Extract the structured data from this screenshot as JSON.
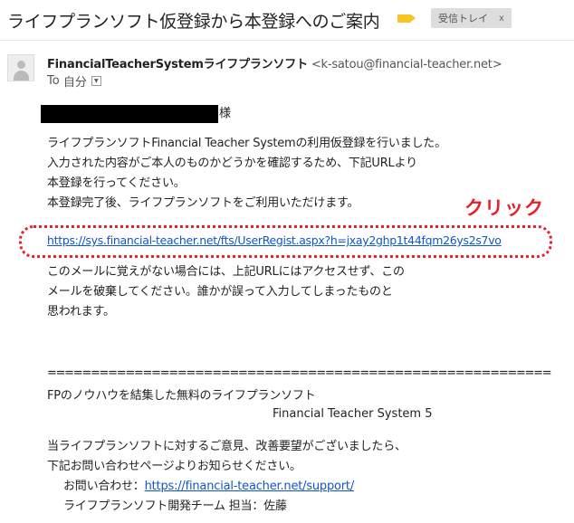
{
  "email": {
    "subject": "ライフプランソフト仮登録から本登録へのご案内",
    "label": {
      "text": "受信トレイ",
      "close": "x",
      "color": "#f3c624"
    },
    "sender": {
      "name": "FinancialTeacherSystemライフプランソフト",
      "email": "<k-satou@financial-teacher.net>"
    },
    "to": {
      "prefix": "To",
      "value": "自分"
    },
    "salutation": "様",
    "paragraph1": [
      "ライフプランソフトFinancial Teacher Systemの利用仮登録を行いました。",
      "入力された内容がご本人のものかどうかを確認するため、下記URLより",
      "本登録を行ってください。",
      "本登録完了後、ライフプランソフトをご利用いただけます。"
    ],
    "annotation": {
      "text": "クリック",
      "color": "#e8202a"
    },
    "registration_link": "https://sys.financial-teacher.net/fts/UserRegist.aspx?h=jxay2ghp1t44fqm26ys2s7vo",
    "paragraph2": [
      "このメールに覚えがない場合には、上記URLにはアクセスせず、この",
      "メールを破棄してください。誰かが誤って入力してしまったものと",
      "思われます。"
    ],
    "divider": "==========================================================",
    "signature": {
      "line1": "FPのノウハウを結集した無料のライフプランソフト",
      "line2": "Financial Teacher System 5",
      "line3": "当ライフプランソフトに対するご意見、改善要望がございましたら、",
      "line4": "下記お問い合わせページよりお知らせください。",
      "contact_label": "お問い合わせ：",
      "contact_link": "https://financial-teacher.net/support/",
      "team": "ライフプランソフト開発チーム 担当：佐藤"
    }
  }
}
